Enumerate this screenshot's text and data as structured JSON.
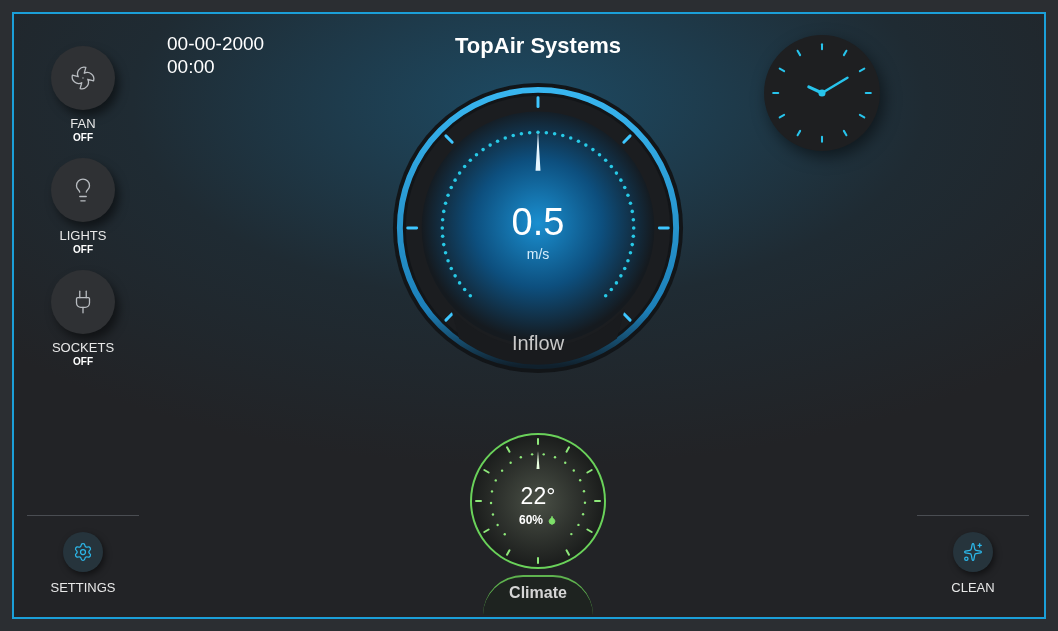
{
  "header": {
    "date": "00-00-2000",
    "time": "00:00",
    "title": "TopAir Systems"
  },
  "devices": [
    {
      "kind": "fan",
      "label": "FAN",
      "status": "OFF",
      "on": false
    },
    {
      "kind": "light",
      "label": "LIGHTS",
      "status": "OFF",
      "on": false
    },
    {
      "kind": "socket",
      "label": "SOCKETS",
      "status": "OFF",
      "on": false
    }
  ],
  "airflow": {
    "value": "0.5",
    "unit": "m/s",
    "label": "Inflow"
  },
  "climate": {
    "temperature": "22°",
    "humidity": "60%",
    "label": "Climate"
  },
  "actions": [
    {
      "kind": "settings",
      "label": "SETTINGS"
    },
    {
      "kind": "clean",
      "label": "CLEAN"
    }
  ]
}
